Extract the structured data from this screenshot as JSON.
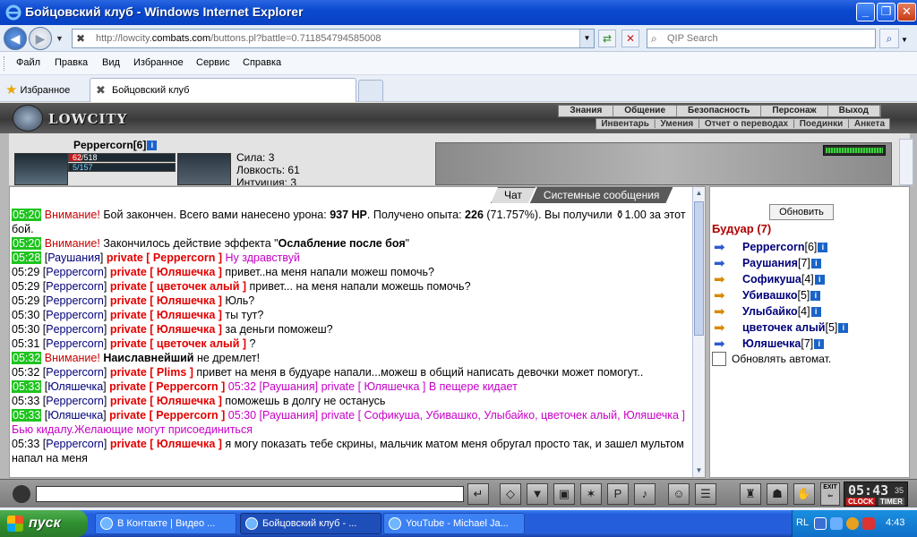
{
  "window": {
    "title": "Бойцовский клуб - Windows Internet Explorer"
  },
  "address": {
    "url_prefix": "http://lowcity.",
    "url_domain": "combats.com",
    "url_suffix": "/buttons.pl?battle=0.711854794585008",
    "search_placeholder": "QIP Search"
  },
  "menu": [
    "Файл",
    "Правка",
    "Вид",
    "Избранное",
    "Сервис",
    "Справка"
  ],
  "favorites": {
    "label": "Избранное"
  },
  "tab": {
    "label": "Бойцовский клуб"
  },
  "game": {
    "logo": "LOWCITY",
    "topnav": [
      "Знания",
      "Общение",
      "Безопасность",
      "Персонаж",
      "Выход"
    ],
    "subnav": [
      "Инвентарь",
      "Умения",
      "Отчет о переводах",
      "Поединки",
      "Анкета"
    ],
    "character": {
      "name": "Peppercorn",
      "level": "[6]",
      "hp_current": "62",
      "hp_max": "/518",
      "mp": "5/157",
      "hp_fraction": 0.12,
      "stats": [
        "Сила: 3",
        "Ловкость: 61",
        "Интуиция: 3"
      ]
    },
    "chat_tabs": [
      "Чат",
      "Системные сообщения"
    ],
    "chat": [
      {
        "time": "05:20",
        "hl": true,
        "parts": [
          {
            "cls": "warn",
            "text": "Внимание! "
          },
          {
            "cls": "tn",
            "text": "Бой закончен. Всего вами нанесено урона: "
          },
          {
            "cls": "tn b",
            "text": "937 HP"
          },
          {
            "cls": "tn",
            "text": ". Получено опыта: "
          },
          {
            "cls": "tn b",
            "text": "226"
          },
          {
            "cls": "tn",
            "text": " (71.757%). Вы получили ⚱1.00 за этот бой."
          }
        ]
      },
      {
        "time": "05:20",
        "hl": true,
        "parts": [
          {
            "cls": "warn",
            "text": "Внимание! "
          },
          {
            "cls": "tn",
            "text": "Закончилось действие эффекта \""
          },
          {
            "cls": "tn b",
            "text": "Ослабление после боя"
          },
          {
            "cls": "tn",
            "text": "\""
          }
        ]
      },
      {
        "time": "05:28",
        "hl": true,
        "parts": [
          {
            "cls": "tn",
            "text": "["
          },
          {
            "cls": "nick",
            "text": "Раушания"
          },
          {
            "cls": "tn",
            "text": "] "
          },
          {
            "cls": "priv",
            "text": "private [ Peppercorn ] "
          },
          {
            "cls": "magenta",
            "text": "Ну здравствуй"
          }
        ]
      },
      {
        "time": "05:29",
        "hl": false,
        "parts": [
          {
            "cls": "tn",
            "text": "["
          },
          {
            "cls": "nick",
            "text": "Peppercorn"
          },
          {
            "cls": "tn",
            "text": "] "
          },
          {
            "cls": "priv",
            "text": "private [ Юляшечка ] "
          },
          {
            "cls": "tn",
            "text": "привет..на меня напали можеш помочь?"
          }
        ]
      },
      {
        "time": "05:29",
        "hl": false,
        "parts": [
          {
            "cls": "tn",
            "text": "["
          },
          {
            "cls": "nick",
            "text": "Peppercorn"
          },
          {
            "cls": "tn",
            "text": "] "
          },
          {
            "cls": "priv",
            "text": "private [ цветочек алый ] "
          },
          {
            "cls": "tn",
            "text": "привет... на меня напали можешь помочь?"
          }
        ]
      },
      {
        "time": "05:29",
        "hl": false,
        "parts": [
          {
            "cls": "tn",
            "text": "["
          },
          {
            "cls": "nick",
            "text": "Peppercorn"
          },
          {
            "cls": "tn",
            "text": "] "
          },
          {
            "cls": "priv",
            "text": "private [ Юляшечка ] "
          },
          {
            "cls": "tn",
            "text": "Юль?"
          }
        ]
      },
      {
        "time": "05:30",
        "hl": false,
        "parts": [
          {
            "cls": "tn",
            "text": "["
          },
          {
            "cls": "nick",
            "text": "Peppercorn"
          },
          {
            "cls": "tn",
            "text": "] "
          },
          {
            "cls": "priv",
            "text": "private [ Юляшечка ] "
          },
          {
            "cls": "tn",
            "text": "ты тут?"
          }
        ]
      },
      {
        "time": "05:30",
        "hl": false,
        "parts": [
          {
            "cls": "tn",
            "text": "["
          },
          {
            "cls": "nick",
            "text": "Peppercorn"
          },
          {
            "cls": "tn",
            "text": "] "
          },
          {
            "cls": "priv",
            "text": "private [ Юляшечка ] "
          },
          {
            "cls": "tn",
            "text": "за деньги поможеш?"
          }
        ]
      },
      {
        "time": "05:31",
        "hl": false,
        "parts": [
          {
            "cls": "tn",
            "text": "["
          },
          {
            "cls": "nick",
            "text": "Peppercorn"
          },
          {
            "cls": "tn",
            "text": "] "
          },
          {
            "cls": "priv",
            "text": "private [ цветочек алый ] "
          },
          {
            "cls": "tn",
            "text": "?"
          }
        ]
      },
      {
        "time": "05:32",
        "hl": true,
        "parts": [
          {
            "cls": "warn",
            "text": "Внимание! "
          },
          {
            "cls": "tn b",
            "text": "Наиславнейший"
          },
          {
            "cls": "tn",
            "text": " не дремлет!"
          }
        ]
      },
      {
        "time": "05:32",
        "hl": false,
        "parts": [
          {
            "cls": "tn",
            "text": "["
          },
          {
            "cls": "nick",
            "text": "Peppercorn"
          },
          {
            "cls": "tn",
            "text": "] "
          },
          {
            "cls": "priv",
            "text": "private [ Plims ] "
          },
          {
            "cls": "tn",
            "text": "привет на меня в будуаре напали...можеш в общий написать девочки может помогут.."
          }
        ]
      },
      {
        "time": "05:33",
        "hl": true,
        "parts": [
          {
            "cls": "tn",
            "text": "["
          },
          {
            "cls": "nick",
            "text": "Юляшечка"
          },
          {
            "cls": "tn",
            "text": "] "
          },
          {
            "cls": "priv",
            "text": "private [ Peppercorn ] "
          },
          {
            "cls": "magenta",
            "text": "05:32 [Раушания] private [ Юляшечка ] В пещере кидает"
          }
        ]
      },
      {
        "time": "05:33",
        "hl": false,
        "parts": [
          {
            "cls": "tn",
            "text": "["
          },
          {
            "cls": "nick",
            "text": "Peppercorn"
          },
          {
            "cls": "tn",
            "text": "] "
          },
          {
            "cls": "priv",
            "text": "private [ Юляшечка ] "
          },
          {
            "cls": "tn",
            "text": "поможешь в долгу не останусь"
          }
        ]
      },
      {
        "time": "05:33",
        "hl": true,
        "parts": [
          {
            "cls": "tn",
            "text": "["
          },
          {
            "cls": "nick",
            "text": "Юляшечка"
          },
          {
            "cls": "tn",
            "text": "] "
          },
          {
            "cls": "priv",
            "text": "private [ Peppercorn ] "
          },
          {
            "cls": "magenta",
            "text": "05:30 [Раушания] private [ Софикуша, Убивашко, Улыбайко, цветочек алый, Юляшечка ] Бью кидалу.Желающие могут присоединиться"
          }
        ]
      },
      {
        "time": "05:33",
        "hl": false,
        "parts": [
          {
            "cls": "tn",
            "text": "["
          },
          {
            "cls": "nick",
            "text": "Peppercorn"
          },
          {
            "cls": "tn",
            "text": "] "
          },
          {
            "cls": "priv",
            "text": "private [ Юляшечка ] "
          },
          {
            "cls": "tn",
            "text": "я могу показать тебе скрины, мальчик матом меня обругал просто так, и зашел мультом напал на меня"
          }
        ]
      }
    ],
    "room": {
      "refresh_label": "Обновить",
      "title": "Будуар (7)",
      "members": [
        {
          "name": "Peppercorn",
          "level": "[6]",
          "arrow": "blue"
        },
        {
          "name": "Раушания",
          "level": "[7]",
          "arrow": "blue"
        },
        {
          "name": "Софикуша",
          "level": "[4]",
          "arrow": "orange"
        },
        {
          "name": "Убивашко",
          "level": "[5]",
          "arrow": "orange"
        },
        {
          "name": "Улыбайко",
          "level": "[4]",
          "arrow": "orange"
        },
        {
          "name": "цветочек алый",
          "level": "[5]",
          "arrow": "orange"
        },
        {
          "name": "Юляшечка",
          "level": "[7]",
          "arrow": "blue"
        }
      ],
      "auto_refresh_label": "Обновлять автомат."
    },
    "clock": {
      "time": "05:43",
      "seconds": "35",
      "clock_label": "CLOCK",
      "timer_label": "TIMER"
    },
    "exit_label": "EXIT"
  },
  "taskbar": {
    "start_label": "пуск",
    "items": [
      "В Контакте | Видео ...",
      "Бойцовский клуб - ...",
      "YouTube - Michael Ja..."
    ],
    "lang": "RL",
    "time": "4:43"
  }
}
